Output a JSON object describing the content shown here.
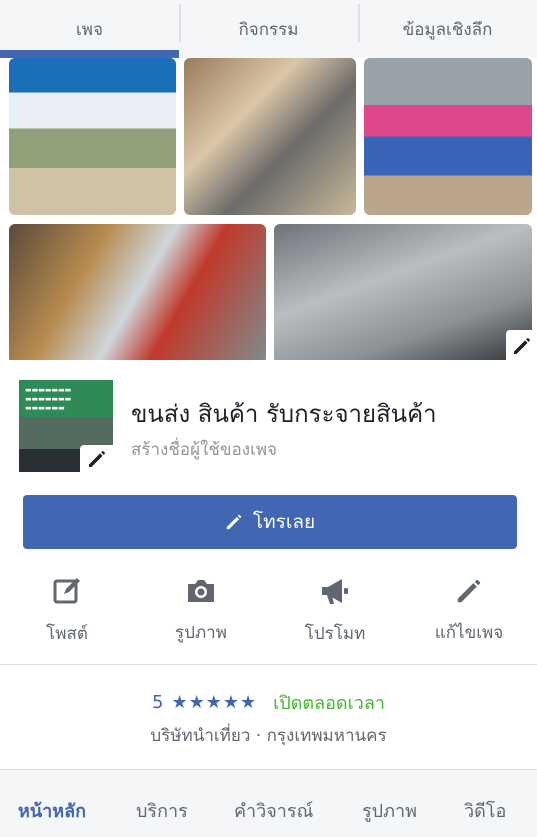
{
  "top_tabs": [
    {
      "label": "เพจ"
    },
    {
      "label": "กิจกรรม"
    },
    {
      "label": "ข้อมูลเชิงลึก"
    }
  ],
  "profile": {
    "page_name": "ขนส่ง สินค้า รับกระจายสินค้า",
    "username_prompt": "สร้างชื่อผู้ใช้ของเพจ"
  },
  "call_button": {
    "label": "โทรเลย"
  },
  "actions": [
    {
      "label": "โพสต์",
      "icon": "compose-icon"
    },
    {
      "label": "รูปภาพ",
      "icon": "camera-icon"
    },
    {
      "label": "โปรโมท",
      "icon": "megaphone-icon"
    },
    {
      "label": "แก้ไขเพจ",
      "icon": "pencil-icon"
    }
  ],
  "rating": {
    "score": "5",
    "stars": "★★★★★",
    "status": "เปิดตลอดเวลา"
  },
  "category_location": "บริษัทนำเที่ยว · กรุงเทพมหานคร",
  "bottom_tabs": [
    {
      "label": "หน้าหลัก"
    },
    {
      "label": "บริการ"
    },
    {
      "label": "คำวิจารณ์"
    },
    {
      "label": "รูปภาพ"
    },
    {
      "label": "วิดีโอ"
    }
  ],
  "colors": {
    "accent": "#4267b2",
    "open_status": "#42b72a"
  }
}
